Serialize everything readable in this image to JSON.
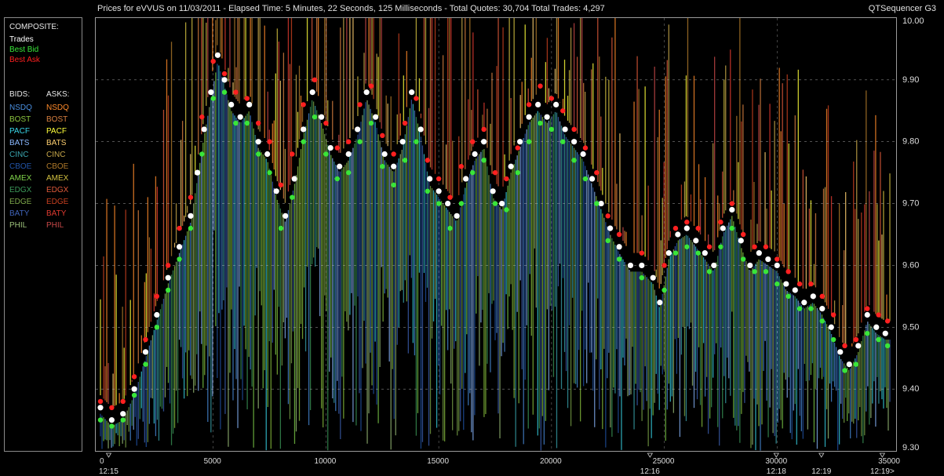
{
  "header": {
    "title": "Prices for  eVVUS  on  11/03/2011  -  Elapsed Time: 5 Minutes, 22 Seconds, 125 Milliseconds  -  Total Quotes: 30,704  Total Trades: 4,297",
    "app_name": "QTSequencer G3"
  },
  "legend": {
    "composite_title": "COMPOSITE:",
    "composite": [
      {
        "label": "Trades",
        "color": "#ffffff"
      },
      {
        "label": "Best Bid",
        "color": "#39e639"
      },
      {
        "label": "Best Ask",
        "color": "#ff2020"
      }
    ],
    "bids_title": "BIDS:",
    "asks_title": "ASKS:",
    "bids": [
      {
        "label": "NSDQ",
        "color": "#4a8fe0"
      },
      {
        "label": "BOST",
        "color": "#8cc63f"
      },
      {
        "label": "PACF",
        "color": "#38d6e8"
      },
      {
        "label": "BATS",
        "color": "#8ab8ff"
      },
      {
        "label": "CINC",
        "color": "#3aa6b0"
      },
      {
        "label": "CBOE",
        "color": "#2255aa"
      },
      {
        "label": "AMEX",
        "color": "#7fd14a"
      },
      {
        "label": "EDGX",
        "color": "#3c9a5a"
      },
      {
        "label": "EDGE",
        "color": "#7ea84a"
      },
      {
        "label": "BATY",
        "color": "#3f63b8"
      },
      {
        "label": "PHIL",
        "color": "#9cc07a"
      }
    ],
    "asks": [
      {
        "label": "NSDQ",
        "color": "#ff8a2a"
      },
      {
        "label": "BOST",
        "color": "#d98040"
      },
      {
        "label": "PACF",
        "color": "#ffff3a"
      },
      {
        "label": "BATS",
        "color": "#ffd070"
      },
      {
        "label": "CINC",
        "color": "#c8a84a"
      },
      {
        "label": "CBOE",
        "color": "#b07a2a"
      },
      {
        "label": "AMEX",
        "color": "#d2c040"
      },
      {
        "label": "EDGX",
        "color": "#e05a3a"
      },
      {
        "label": "EDGE",
        "color": "#c84020"
      },
      {
        "label": "BATY",
        "color": "#e03a30"
      },
      {
        "label": "PHIL",
        "color": "#c84848"
      }
    ]
  },
  "chart_data": {
    "type": "scatter",
    "xlim": [
      0,
      35000
    ],
    "ylim": [
      9.3,
      10.0
    ],
    "x_ticks": [
      0,
      5000,
      10000,
      15000,
      20000,
      25000,
      30000,
      35000
    ],
    "y_ticks": [
      "9.30",
      "9.40",
      "9.50",
      "9.60",
      "9.70",
      "9.80",
      "9.90",
      "10.00"
    ],
    "time_labels": [
      {
        "x": 400,
        "label": "12:15"
      },
      {
        "x": 24400,
        "label": "12:16"
      },
      {
        "x": 30000,
        "label": "12:18"
      },
      {
        "x": 32000,
        "label": "12:19"
      },
      {
        "x": 34700,
        "label": "12:19>"
      }
    ],
    "grid": true,
    "series": [
      {
        "name": "Trades",
        "color": "#ffffff",
        "points": [
          [
            0,
            9.37
          ],
          [
            500,
            9.35
          ],
          [
            1000,
            9.36
          ],
          [
            1500,
            9.4
          ],
          [
            2000,
            9.46
          ],
          [
            2500,
            9.52
          ],
          [
            3000,
            9.58
          ],
          [
            3500,
            9.63
          ],
          [
            4000,
            9.68
          ],
          [
            4300,
            9.75
          ],
          [
            4600,
            9.82
          ],
          [
            4900,
            9.88
          ],
          [
            5200,
            9.94
          ],
          [
            5500,
            9.9
          ],
          [
            5800,
            9.86
          ],
          [
            6200,
            9.84
          ],
          [
            6600,
            9.86
          ],
          [
            7000,
            9.8
          ],
          [
            7400,
            9.78
          ],
          [
            7800,
            9.72
          ],
          [
            8200,
            9.68
          ],
          [
            8600,
            9.74
          ],
          [
            9000,
            9.82
          ],
          [
            9400,
            9.88
          ],
          [
            9800,
            9.84
          ],
          [
            10200,
            9.79
          ],
          [
            10600,
            9.76
          ],
          [
            11000,
            9.78
          ],
          [
            11400,
            9.82
          ],
          [
            11800,
            9.88
          ],
          [
            12200,
            9.84
          ],
          [
            12600,
            9.78
          ],
          [
            13000,
            9.76
          ],
          [
            13400,
            9.8
          ],
          [
            13800,
            9.88
          ],
          [
            14200,
            9.82
          ],
          [
            14600,
            9.74
          ],
          [
            15000,
            9.72
          ],
          [
            15400,
            9.7
          ],
          [
            15800,
            9.68
          ],
          [
            16200,
            9.74
          ],
          [
            16600,
            9.78
          ],
          [
            17000,
            9.8
          ],
          [
            17400,
            9.72
          ],
          [
            17800,
            9.7
          ],
          [
            18200,
            9.76
          ],
          [
            18600,
            9.8
          ],
          [
            19000,
            9.84
          ],
          [
            19400,
            9.86
          ],
          [
            19800,
            9.84
          ],
          [
            20200,
            9.86
          ],
          [
            20600,
            9.82
          ],
          [
            21000,
            9.8
          ],
          [
            21400,
            9.78
          ],
          [
            21800,
            9.74
          ],
          [
            22200,
            9.7
          ],
          [
            22600,
            9.66
          ],
          [
            23000,
            9.63
          ],
          [
            23500,
            9.6
          ],
          [
            24000,
            9.6
          ],
          [
            24500,
            9.58
          ],
          [
            24800,
            9.54
          ],
          [
            25200,
            9.62
          ],
          [
            25600,
            9.65
          ],
          [
            26000,
            9.66
          ],
          [
            26400,
            9.64
          ],
          [
            26800,
            9.62
          ],
          [
            27200,
            9.6
          ],
          [
            27600,
            9.66
          ],
          [
            28000,
            9.69
          ],
          [
            28400,
            9.64
          ],
          [
            28800,
            9.6
          ],
          [
            29200,
            9.62
          ],
          [
            29600,
            9.61
          ],
          [
            30000,
            9.6
          ],
          [
            30400,
            9.57
          ],
          [
            30800,
            9.56
          ],
          [
            31200,
            9.54
          ],
          [
            31600,
            9.55
          ],
          [
            32000,
            9.53
          ],
          [
            32400,
            9.5
          ],
          [
            32800,
            9.46
          ],
          [
            33200,
            9.44
          ],
          [
            33600,
            9.47
          ],
          [
            34000,
            9.52
          ],
          [
            34400,
            9.5
          ],
          [
            34800,
            9.49
          ]
        ]
      },
      {
        "name": "Best Bid",
        "color": "#39e639",
        "points": [
          [
            0,
            9.35
          ],
          [
            500,
            9.34
          ],
          [
            1000,
            9.35
          ],
          [
            1500,
            9.39
          ],
          [
            2000,
            9.44
          ],
          [
            2500,
            9.5
          ],
          [
            3000,
            9.56
          ],
          [
            3500,
            9.61
          ],
          [
            4000,
            9.66
          ],
          [
            4500,
            9.78
          ],
          [
            5000,
            9.87
          ],
          [
            5500,
            9.88
          ],
          [
            6000,
            9.83
          ],
          [
            6500,
            9.83
          ],
          [
            7000,
            9.78
          ],
          [
            7500,
            9.75
          ],
          [
            8000,
            9.66
          ],
          [
            8500,
            9.71
          ],
          [
            9000,
            9.8
          ],
          [
            9500,
            9.84
          ],
          [
            10000,
            9.78
          ],
          [
            10500,
            9.74
          ],
          [
            11000,
            9.75
          ],
          [
            11500,
            9.8
          ],
          [
            12000,
            9.83
          ],
          [
            12500,
            9.76
          ],
          [
            13000,
            9.73
          ],
          [
            13500,
            9.77
          ],
          [
            14000,
            9.8
          ],
          [
            14500,
            9.72
          ],
          [
            15000,
            9.7
          ],
          [
            15500,
            9.66
          ],
          [
            16000,
            9.7
          ],
          [
            16500,
            9.75
          ],
          [
            17000,
            9.77
          ],
          [
            17500,
            9.7
          ],
          [
            18000,
            9.69
          ],
          [
            18500,
            9.75
          ],
          [
            19000,
            9.8
          ],
          [
            19500,
            9.83
          ],
          [
            20000,
            9.82
          ],
          [
            20500,
            9.8
          ],
          [
            21000,
            9.77
          ],
          [
            21500,
            9.74
          ],
          [
            22000,
            9.7
          ],
          [
            22500,
            9.64
          ],
          [
            23000,
            9.61
          ],
          [
            24000,
            9.58
          ],
          [
            25000,
            9.56
          ],
          [
            25500,
            9.62
          ],
          [
            26000,
            9.63
          ],
          [
            26500,
            9.62
          ],
          [
            27000,
            9.59
          ],
          [
            27500,
            9.63
          ],
          [
            28000,
            9.66
          ],
          [
            28500,
            9.61
          ],
          [
            29000,
            9.59
          ],
          [
            29500,
            9.59
          ],
          [
            30000,
            9.57
          ],
          [
            30500,
            9.55
          ],
          [
            31000,
            9.53
          ],
          [
            31500,
            9.53
          ],
          [
            32000,
            9.51
          ],
          [
            32500,
            9.48
          ],
          [
            33000,
            9.43
          ],
          [
            33500,
            9.44
          ],
          [
            34000,
            9.49
          ],
          [
            34500,
            9.48
          ],
          [
            34900,
            9.47
          ]
        ]
      },
      {
        "name": "Best Ask",
        "color": "#ff2020",
        "points": [
          [
            0,
            9.38
          ],
          [
            500,
            9.37
          ],
          [
            1000,
            9.38
          ],
          [
            1500,
            9.42
          ],
          [
            2000,
            9.48
          ],
          [
            2500,
            9.55
          ],
          [
            3000,
            9.6
          ],
          [
            3500,
            9.66
          ],
          [
            4000,
            9.71
          ],
          [
            4500,
            9.84
          ],
          [
            5000,
            9.93
          ],
          [
            5500,
            9.91
          ],
          [
            6000,
            9.88
          ],
          [
            6500,
            9.87
          ],
          [
            7000,
            9.83
          ],
          [
            7500,
            9.8
          ],
          [
            8000,
            9.73
          ],
          [
            8500,
            9.78
          ],
          [
            9000,
            9.86
          ],
          [
            9500,
            9.9
          ],
          [
            10000,
            9.83
          ],
          [
            10500,
            9.79
          ],
          [
            11000,
            9.8
          ],
          [
            11500,
            9.86
          ],
          [
            12000,
            9.89
          ],
          [
            12500,
            9.81
          ],
          [
            13000,
            9.78
          ],
          [
            13500,
            9.83
          ],
          [
            14000,
            9.87
          ],
          [
            14500,
            9.77
          ],
          [
            15000,
            9.74
          ],
          [
            15500,
            9.71
          ],
          [
            16000,
            9.76
          ],
          [
            16500,
            9.8
          ],
          [
            17000,
            9.82
          ],
          [
            17500,
            9.75
          ],
          [
            18000,
            9.74
          ],
          [
            18500,
            9.79
          ],
          [
            19000,
            9.86
          ],
          [
            19500,
            9.89
          ],
          [
            20000,
            9.87
          ],
          [
            20500,
            9.85
          ],
          [
            21000,
            9.82
          ],
          [
            21500,
            9.79
          ],
          [
            22000,
            9.75
          ],
          [
            22500,
            9.68
          ],
          [
            23000,
            9.65
          ],
          [
            24000,
            9.62
          ],
          [
            25000,
            9.6
          ],
          [
            25500,
            9.66
          ],
          [
            26000,
            9.67
          ],
          [
            26500,
            9.66
          ],
          [
            27000,
            9.63
          ],
          [
            27500,
            9.67
          ],
          [
            28000,
            9.7
          ],
          [
            28500,
            9.65
          ],
          [
            29000,
            9.63
          ],
          [
            29500,
            9.63
          ],
          [
            30000,
            9.61
          ],
          [
            30500,
            9.59
          ],
          [
            31000,
            9.57
          ],
          [
            31500,
            9.57
          ],
          [
            32000,
            9.55
          ],
          [
            32500,
            9.52
          ],
          [
            33000,
            9.47
          ],
          [
            33500,
            9.48
          ],
          [
            34000,
            9.53
          ],
          [
            34500,
            9.52
          ],
          [
            34900,
            9.51
          ]
        ]
      }
    ]
  }
}
